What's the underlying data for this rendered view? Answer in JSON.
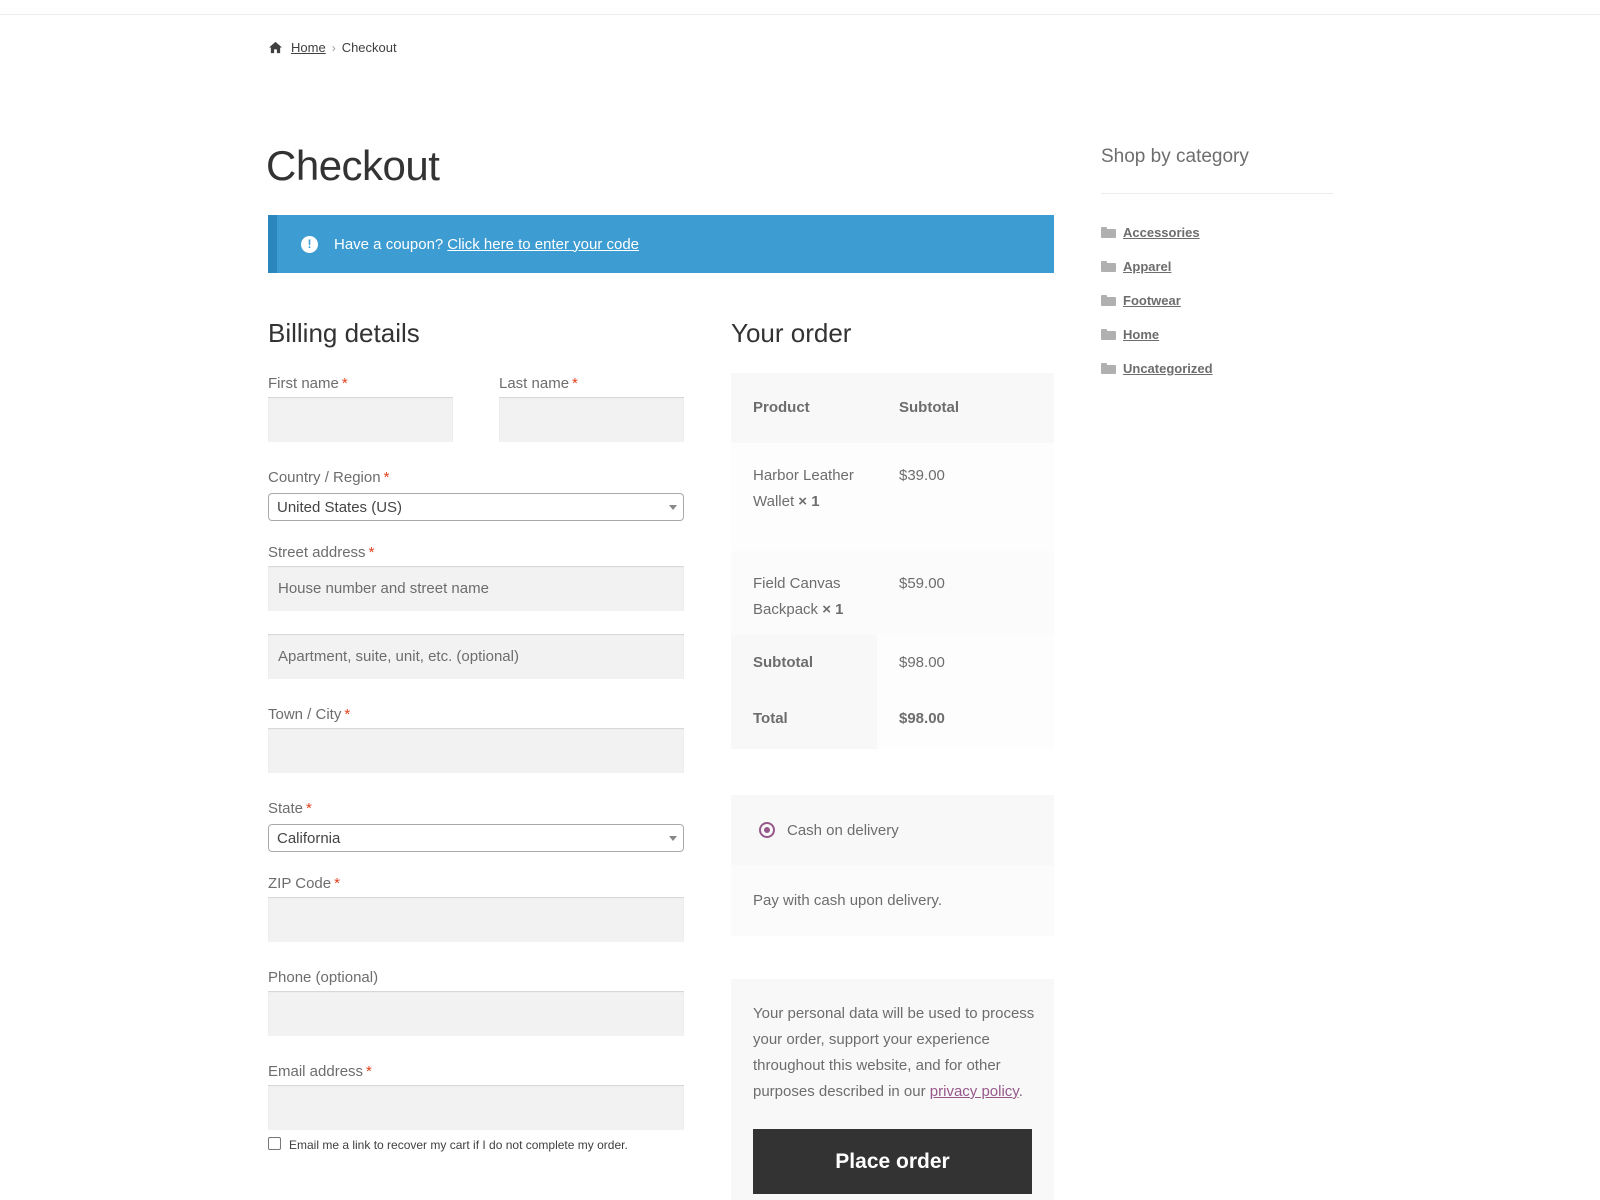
{
  "breadcrumb": {
    "home": "Home",
    "separator": "›",
    "current": "Checkout"
  },
  "page_title": "Checkout",
  "coupon": {
    "text": "Have a coupon?",
    "link": "Click here to enter your code"
  },
  "billing": {
    "heading": "Billing details",
    "required_mark": "*",
    "first_name_label": "First name",
    "last_name_label": "Last name",
    "country_label": "Country / Region",
    "country_value": "United States (US)",
    "street_label": "Street address",
    "street_placeholder": "House number and street name",
    "apartment_placeholder": "Apartment, suite, unit, etc. (optional)",
    "city_label": "Town / City",
    "state_label": "State",
    "state_value": "California",
    "zip_label": "ZIP Code",
    "phone_label": "Phone (optional)",
    "email_label": "Email address",
    "recover_cart_text": "Email me a link to recover my cart if I do not complete my order."
  },
  "order": {
    "heading": "Your order",
    "col_product": "Product",
    "col_subtotal": "Subtotal",
    "items": [
      {
        "name": "Harbor Leather Wallet",
        "qty": "× 1",
        "price": "$39.00"
      },
      {
        "name": "Field Canvas Backpack",
        "qty": "× 1",
        "price": "$59.00"
      }
    ],
    "subtotal_label": "Subtotal",
    "subtotal_value": "$98.00",
    "total_label": "Total",
    "total_value": "$98.00"
  },
  "payment": {
    "method": "Cash on delivery",
    "description": "Pay with cash upon delivery."
  },
  "privacy": {
    "text": "Your personal data will be used to process your order, support your experience throughout this website, and for other purposes described in our",
    "link": "privacy policy",
    "end": "."
  },
  "place_order_label": "Place order",
  "sidebar": {
    "title": "Shop by category",
    "categories": [
      "Accessories",
      "Apparel",
      "Footwear",
      "Home",
      "Uncategorized"
    ]
  },
  "colors": {
    "accent": "#96588a",
    "info": "#3d9cd2",
    "required": "#e2401c",
    "button": "#333333"
  }
}
